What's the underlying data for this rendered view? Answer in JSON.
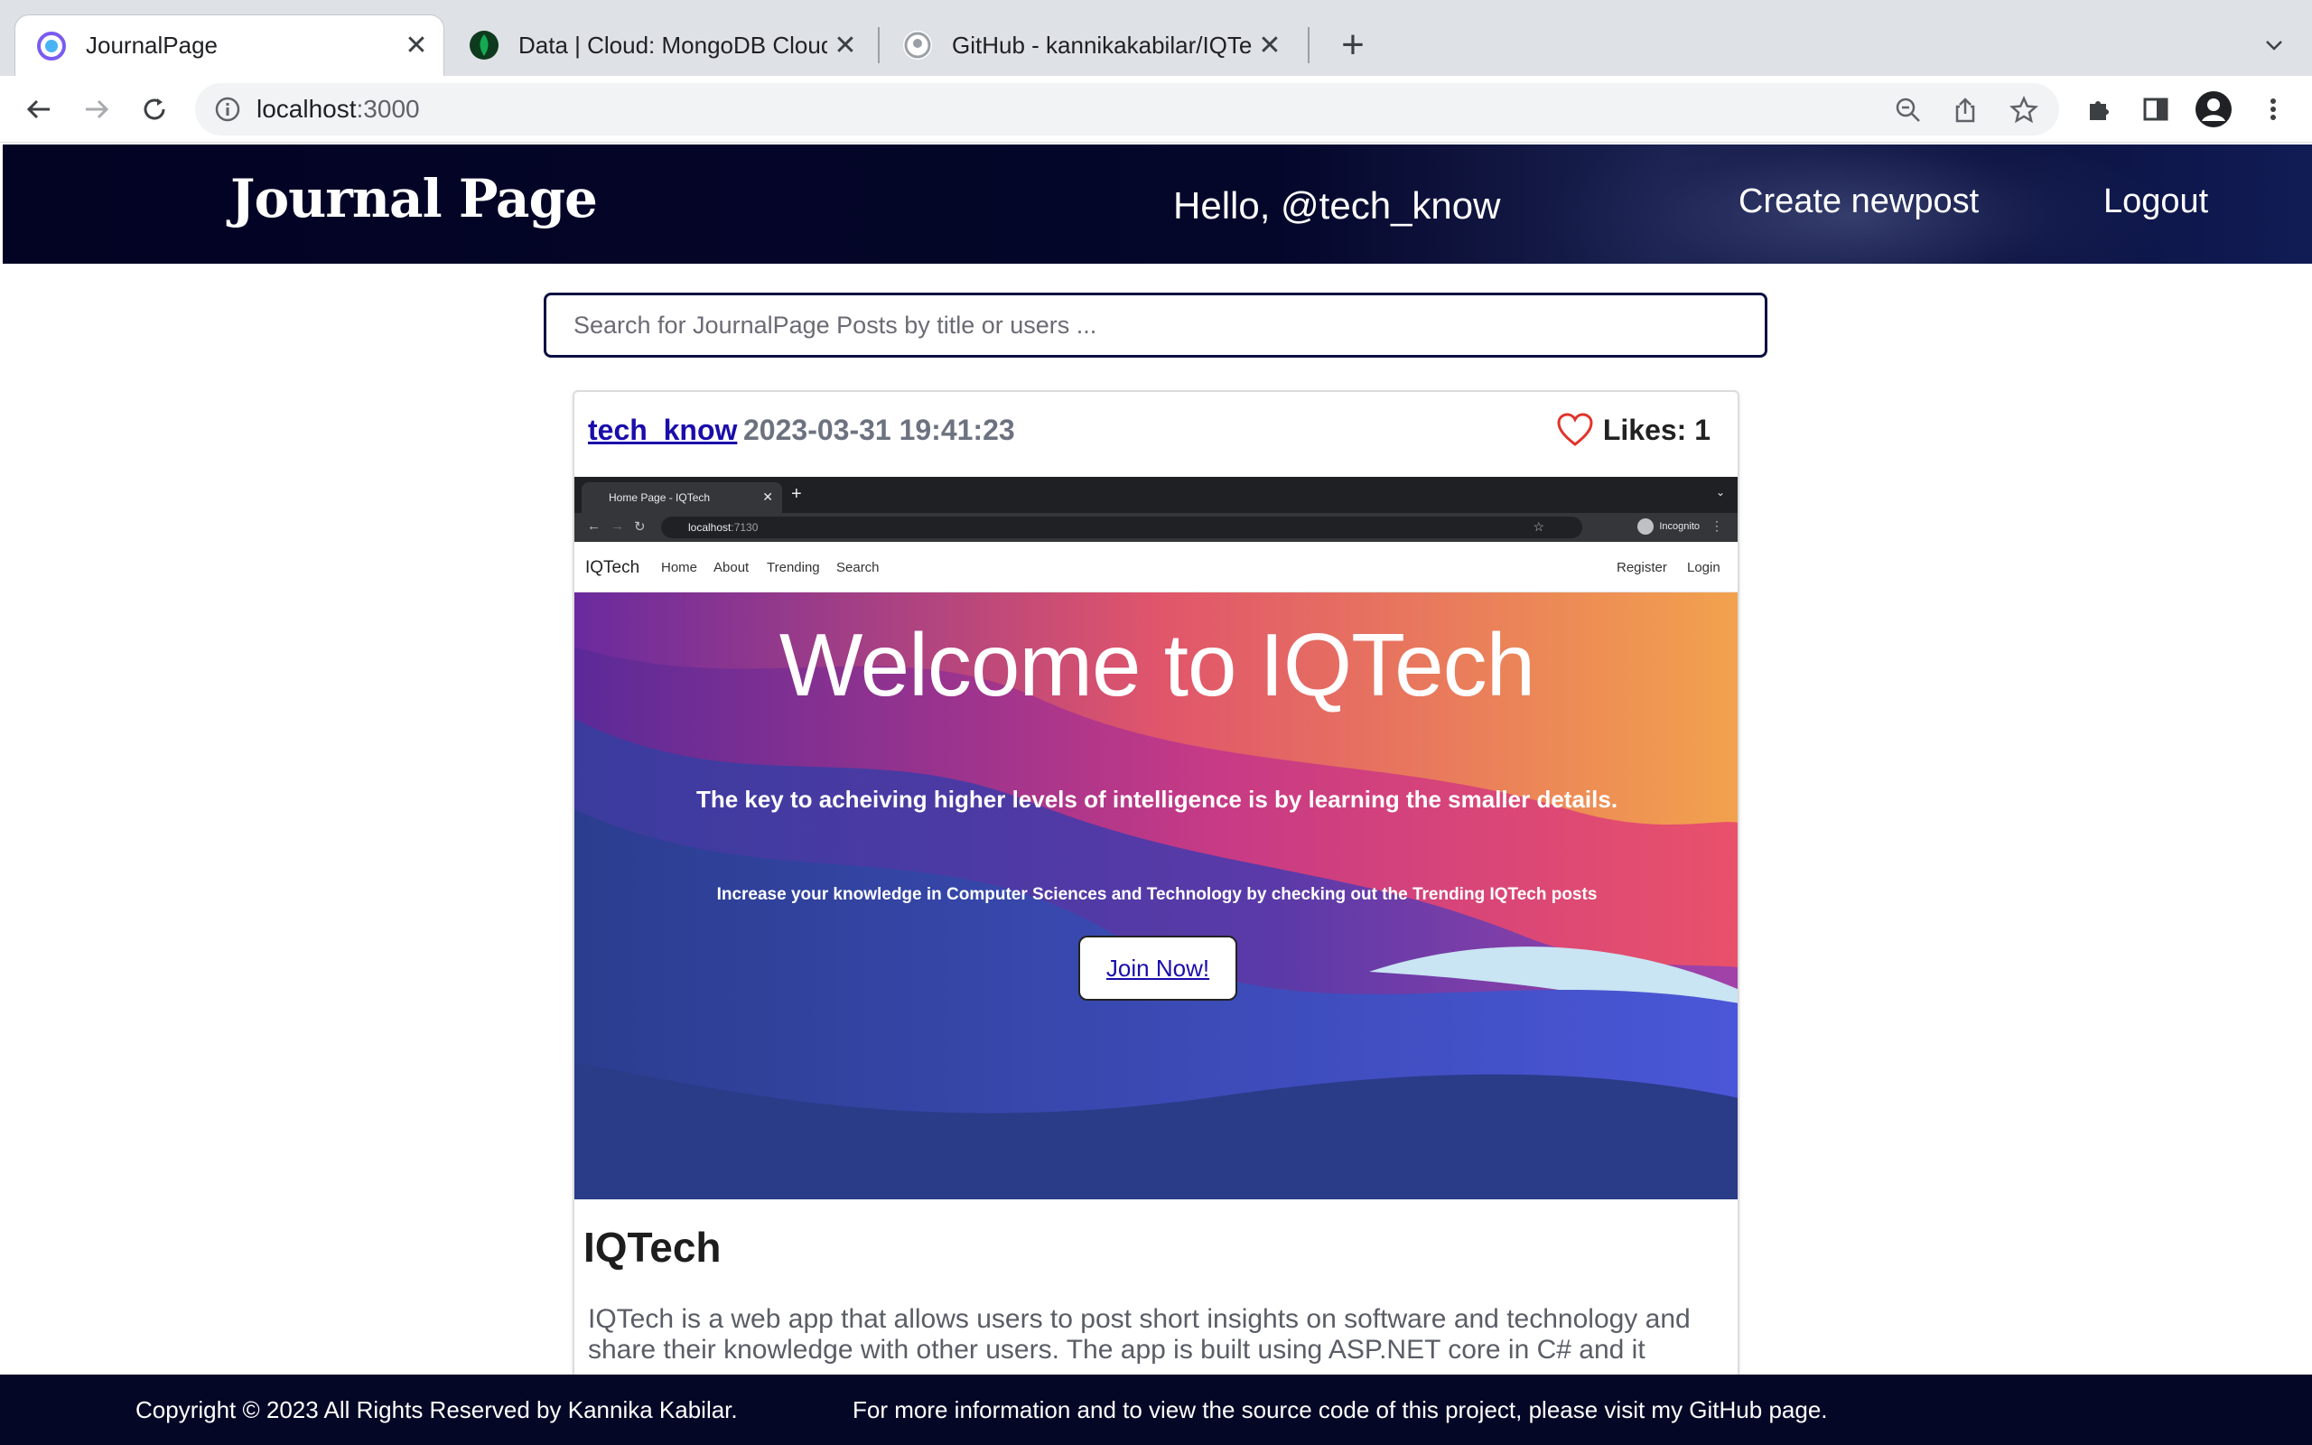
{
  "browser": {
    "tabs": [
      {
        "title": "JournalPage",
        "active": true,
        "favicon": "journalpage-favicon"
      },
      {
        "title": "Data | Cloud: MongoDB Cloud",
        "active": false,
        "favicon": "mongodb-leaf-icon"
      },
      {
        "title": "GitHub - kannikakabilar/IQTech",
        "active": false,
        "favicon": "github-icon"
      }
    ],
    "url_host": "localhost",
    "url_port": ":3000"
  },
  "header": {
    "logo": "Journal Page",
    "greeting": "Hello, @tech_know",
    "create_link": "Create newpost",
    "logout_link": "Logout"
  },
  "search": {
    "placeholder": "Search for JournalPage Posts by title or users ..."
  },
  "post": {
    "author": "tech_know",
    "date": "2023-03-31 19:41:23",
    "likes": "Likes: 1",
    "title": "IQTech",
    "body": "IQTech is a web app that allows users to post short insights on software and technology and share their knowledge with other users. The app is built using ASP.NET core in C# and it",
    "image": {
      "tab_title": "Home Page - IQTech",
      "url_host": "localhost",
      "url_port": ":7130",
      "incognito": "Incognito",
      "brand": "IQTech",
      "nav": [
        "Home",
        "About",
        "Trending",
        "Search"
      ],
      "nav_right": [
        "Register",
        "Login"
      ],
      "hero_title": "Welcome to IQTech",
      "hero_subtitle": "The key to acheiving higher levels of intelligence is by learning the smaller details.",
      "hero_text": "Increase your knowledge in Computer Sciences and Technology by checking out the Trending IQTech posts",
      "hero_button": "Join Now!"
    }
  },
  "footer": {
    "copyright": "Copyright © 2023 All Rights Reserved by Kannika Kabilar.",
    "info": "For more information and to view the source code of this project, please visit my GitHub page."
  },
  "colors": {
    "header_bg": "#030424",
    "footer_bg": "#050726",
    "link": "#1a0dab",
    "heart": "#e0342b"
  }
}
